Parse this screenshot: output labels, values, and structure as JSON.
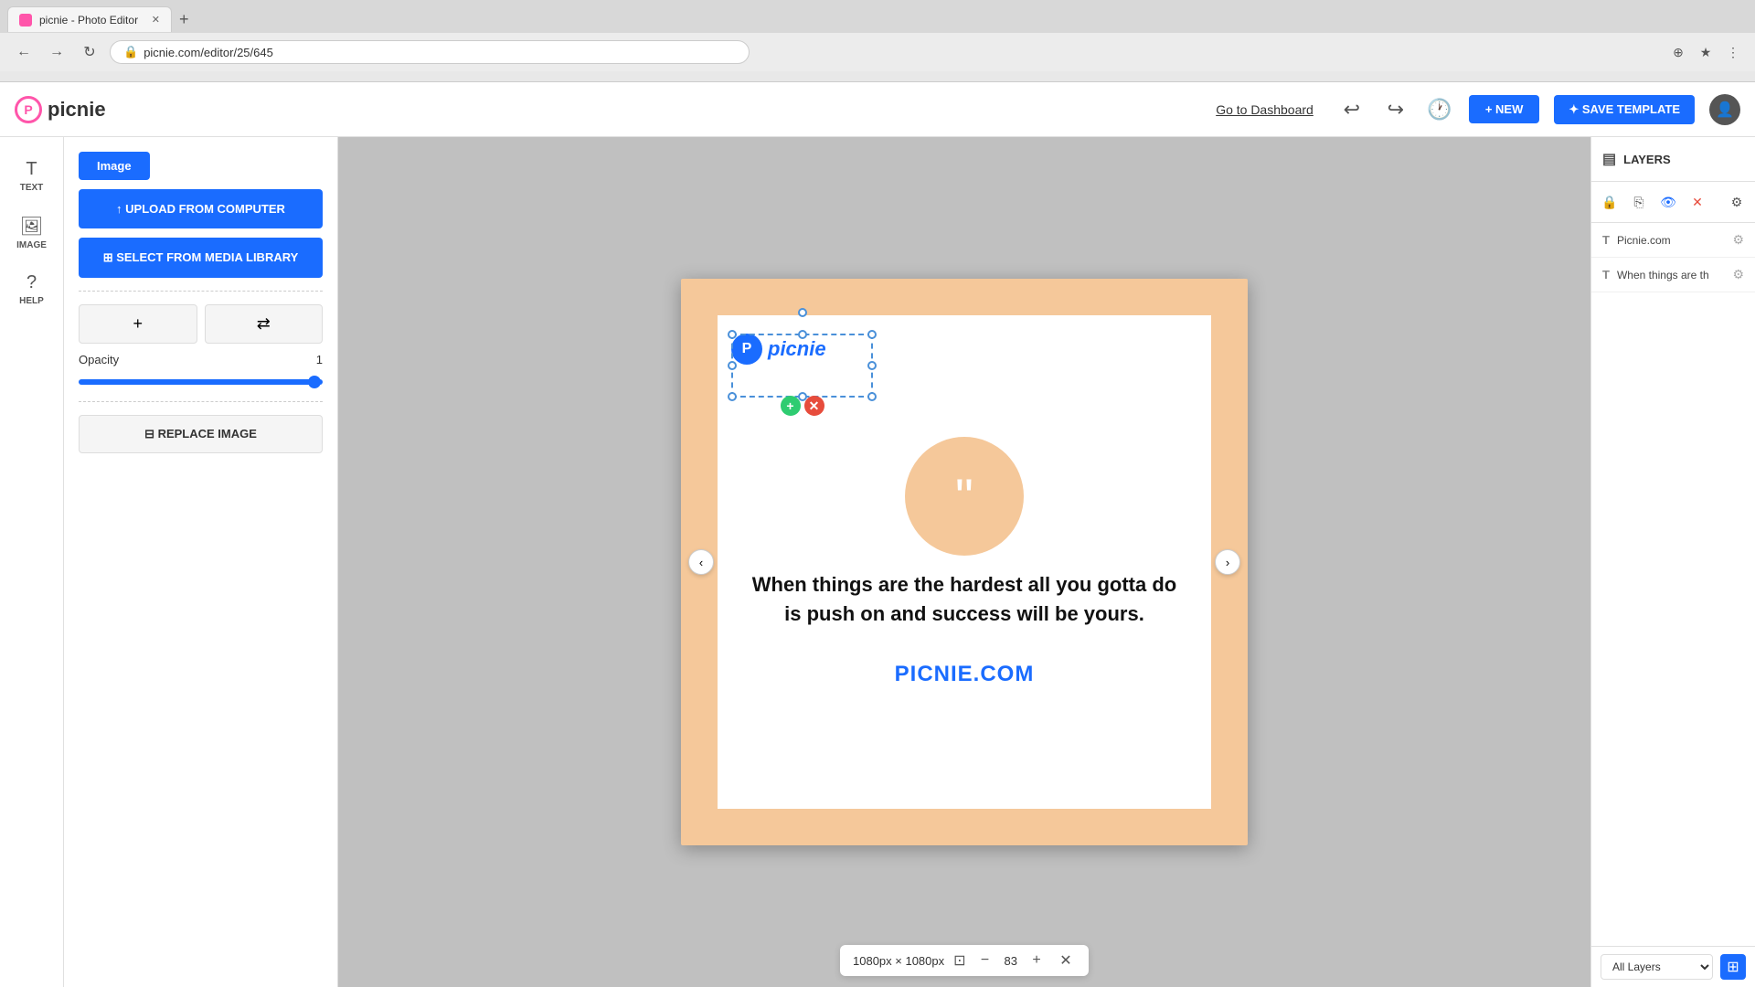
{
  "browser": {
    "tab_title": "picnie - Photo Editor",
    "url": "picnie.com/editor/25/645",
    "new_tab_label": "+"
  },
  "header": {
    "logo_text": "picnie",
    "go_to_dashboard": "Go to Dashboard",
    "new_label": "+ NEW",
    "save_template_label": "✦ SAVE TEMPLATE"
  },
  "left_toolbar": {
    "text_tool": "TEXT",
    "image_tool": "IMAGE",
    "help_tool": "HELP"
  },
  "left_panel": {
    "active_tab": "Image",
    "upload_btn": "↑ UPLOAD FROM COMPUTER",
    "media_btn": "⊞ SELECT FROM MEDIA LIBRARY",
    "opacity_label": "Opacity",
    "opacity_value": "1",
    "replace_btn": "⊟ REPLACE IMAGE"
  },
  "canvas": {
    "quote_text": "When things are the hardest all you gotta do is push on and success will be yours.",
    "brand_url": "PICNIE.COM",
    "logo_text": "picnie",
    "canvas_size": "1080px × 1080px",
    "zoom_level": "83"
  },
  "layers": {
    "title": "LAYERS",
    "layer1_name": "Picnie.com",
    "layer2_name": "When things are th",
    "all_layers_label": "All Layers"
  }
}
